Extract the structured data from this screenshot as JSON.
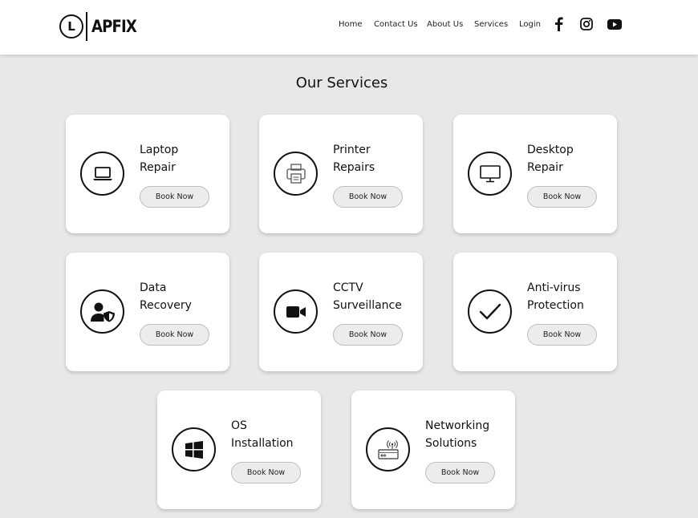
{
  "brand": {
    "logo_letter": "L",
    "name": "APFIX"
  },
  "nav": {
    "links": [
      "Home",
      "Contact Us",
      "About Us",
      "Services",
      "Login"
    ],
    "social": [
      "facebook-icon",
      "instagram-icon",
      "youtube-icon"
    ]
  },
  "section": {
    "title": "Our Services"
  },
  "services": [
    {
      "line1": "Laptop",
      "line2": "Repair",
      "icon": "laptop-icon",
      "button": "Book Now"
    },
    {
      "line1": "Printer",
      "line2": "Repairs",
      "icon": "printer-icon",
      "button": "Book Now"
    },
    {
      "line1": "Desktop",
      "line2": "Repair",
      "icon": "desktop-icon",
      "button": "Book Now"
    },
    {
      "line1": "Data",
      "line2": "Recovery",
      "icon": "user-shield-icon",
      "button": "Book Now"
    },
    {
      "line1": "CCTV",
      "line2": "Surveillance",
      "icon": "video-camera-icon",
      "button": "Book Now"
    },
    {
      "line1": "Anti-virus",
      "line2": "Protection",
      "icon": "checkmark-icon",
      "button": "Book Now"
    },
    {
      "line1": "OS",
      "line2": "Installation",
      "icon": "windows-icon",
      "button": "Book Now"
    },
    {
      "line1": "Networking",
      "line2": "Solutions",
      "icon": "router-icon",
      "button": "Book Now"
    }
  ]
}
